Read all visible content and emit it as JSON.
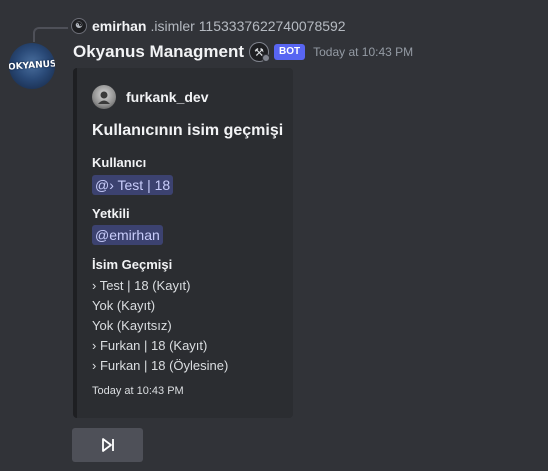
{
  "reply": {
    "username": "emirhan",
    "content": ".isimler 1153337622740078592"
  },
  "avatar": {
    "text": "OKYANUS"
  },
  "message": {
    "author": "Okyanus Managment",
    "bot_badge": "BOT",
    "timestamp": "Today at 10:43 PM"
  },
  "embed": {
    "author_name": "furkank_dev",
    "title": "Kullanıcının isim geçmişi",
    "fields": [
      {
        "name": "Kullanıcı",
        "value": "@› Test | 18"
      },
      {
        "name": "Yetkili",
        "value": "@emirhan"
      },
      {
        "name": "İsim Geçmişi"
      }
    ],
    "history": [
      "› Test | 18 (Kayıt)",
      "Yok (Kayıt)",
      "Yok (Kayıtsız)",
      "› Furkan | 18 (Kayıt)",
      "› Furkan | 18 (Öylesine)"
    ],
    "footer": "Today at 10:43 PM"
  },
  "button": {
    "icon": "skip-next-icon"
  },
  "colors": {
    "background": "#313338",
    "embed_bg": "#2b2d31",
    "bot_badge": "#5865f2",
    "mention_bg": "#3c4270",
    "button_bg": "#4e5058"
  }
}
